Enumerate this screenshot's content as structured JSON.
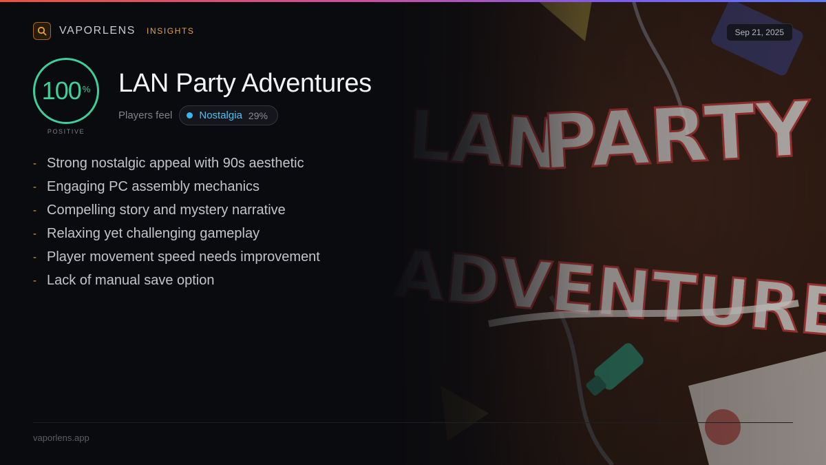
{
  "brand": {
    "name": "VAPORLENS",
    "tag": "INSIGHTS",
    "icon": "search-icon",
    "accent_color": "#e8a23a"
  },
  "date": "Sep 21, 2025",
  "score": {
    "value": "100",
    "unit": "%",
    "label": "POSITIVE",
    "color": "#3ecf9a"
  },
  "game": {
    "title": "LAN Party Adventures"
  },
  "feel": {
    "label": "Players feel",
    "emotion": "Nostalgia",
    "percent": "29%",
    "color": "#38b6f0"
  },
  "points": [
    {
      "bullet": "-",
      "text": "Strong nostalgic appeal with 90s aesthetic"
    },
    {
      "bullet": "-",
      "text": "Engaging PC assembly mechanics"
    },
    {
      "bullet": "-",
      "text": "Compelling story and mystery narrative"
    },
    {
      "bullet": "-",
      "text": "Relaxing yet challenging gameplay"
    },
    {
      "bullet": "-",
      "text": "Player movement speed needs improvement"
    },
    {
      "bullet": "-",
      "text": "Lack of manual save option"
    }
  ],
  "footer": {
    "url": "vaporlens.app"
  }
}
